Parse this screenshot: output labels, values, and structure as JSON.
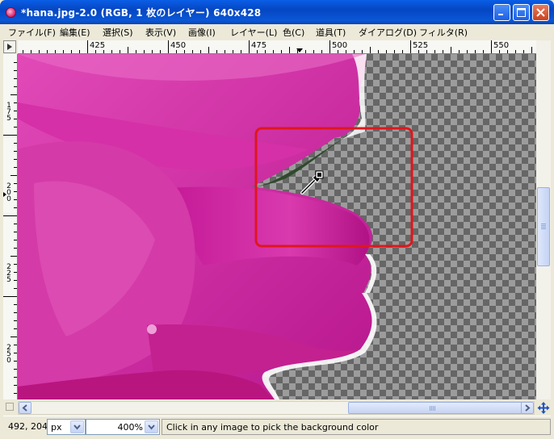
{
  "window": {
    "title": "*hana.jpg-2.0 (RGB, 1 枚のレイヤー) 640x428",
    "minimize_icon": "minimize-icon",
    "maximize_icon": "maximize-icon",
    "close_icon": "close-icon"
  },
  "menu": {
    "items": [
      {
        "label": "ファイル(F)"
      },
      {
        "label": "編集(E)"
      },
      {
        "label": "選択(S)"
      },
      {
        "label": "表示(V)"
      },
      {
        "label": "画像(I)"
      },
      {
        "label": "レイヤー(L)"
      },
      {
        "label": "色(C)"
      },
      {
        "label": "道具(T)"
      },
      {
        "label": "ダイアログ(D)"
      },
      {
        "label": "フィルタ(R)"
      }
    ]
  },
  "rulers": {
    "horizontal": [
      "425",
      "450",
      "475",
      "500",
      "525",
      "550"
    ],
    "vertical": [
      "175",
      "200",
      "225",
      "250"
    ]
  },
  "status": {
    "coords": "492, 204",
    "unit": "px",
    "zoom": "400%",
    "message": "Click in any image to pick the background color"
  },
  "colors": {
    "title_blue": "#0a5ee6",
    "petal_magenta": "#cc1f9e",
    "selection_red": "#e0161c",
    "checker_light": "#9c9c9c",
    "checker_dark": "#666666"
  }
}
